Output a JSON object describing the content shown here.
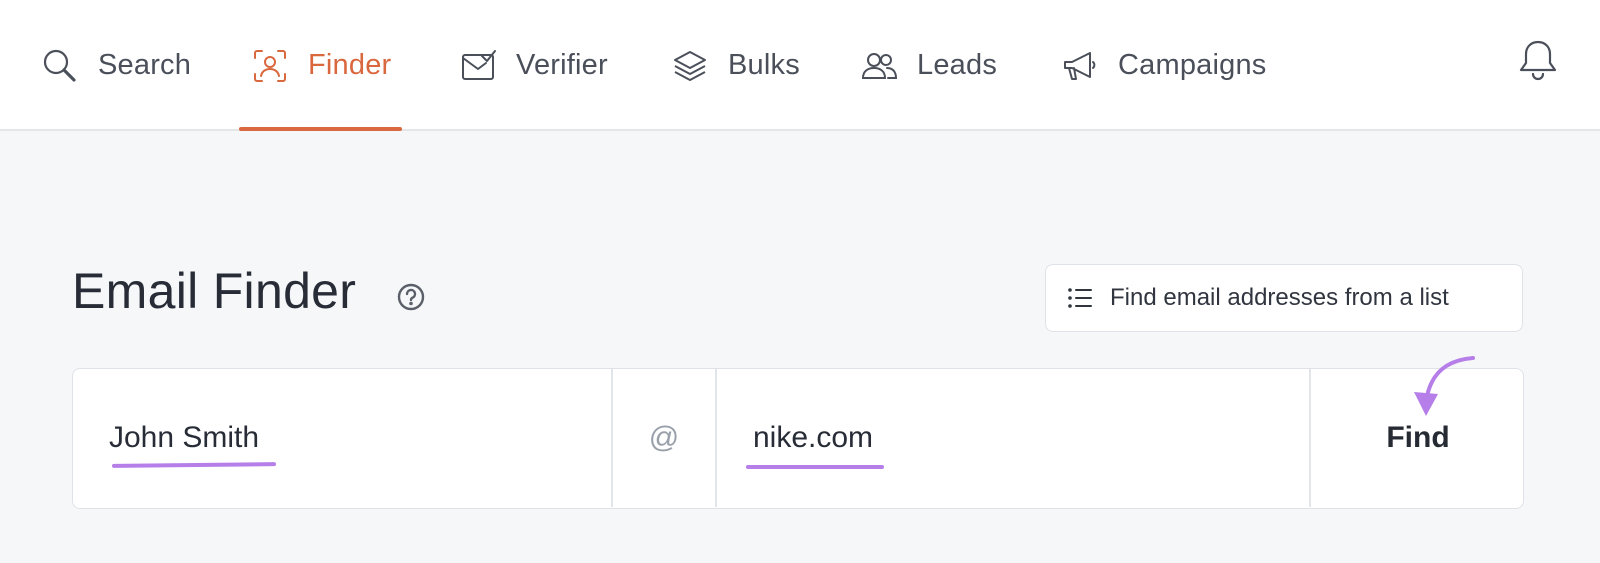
{
  "nav": {
    "items": [
      {
        "label": "Search",
        "icon": "search-icon",
        "active": false
      },
      {
        "label": "Finder",
        "icon": "finder-icon",
        "active": true
      },
      {
        "label": "Verifier",
        "icon": "verifier-icon",
        "active": false
      },
      {
        "label": "Bulks",
        "icon": "layers-icon",
        "active": false
      },
      {
        "label": "Leads",
        "icon": "users-icon",
        "active": false
      },
      {
        "label": "Campaigns",
        "icon": "megaphone-icon",
        "active": false
      }
    ],
    "notifications_icon": "bell-icon"
  },
  "main": {
    "title": "Email Finder",
    "help_icon": "question-circle-icon",
    "list_button": {
      "label": "Find email addresses from a list",
      "icon": "list-icon"
    }
  },
  "search": {
    "name_value": "John Smith",
    "at_sign": "@",
    "domain_value": "nike.com",
    "find_label": "Find"
  },
  "colors": {
    "accent": "#d9683f",
    "annotation": "#b57ee8",
    "background": "#f6f7f9"
  }
}
